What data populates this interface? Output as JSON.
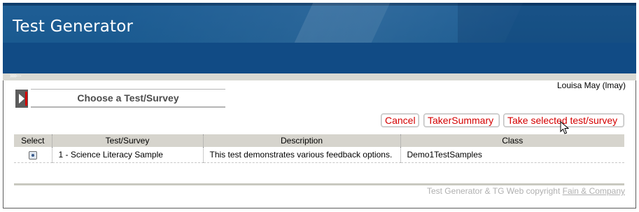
{
  "header": {
    "title": "Test Generator",
    "user": "Louisa May (lmay)"
  },
  "panel": {
    "title": "Choose a Test/Survey"
  },
  "actions": {
    "cancel": "Cancel",
    "taker_summary": "TakerSummary",
    "take_selected": "Take selected test/survey"
  },
  "table": {
    "columns": [
      "Select",
      "Test/Survey",
      "Description",
      "Class"
    ],
    "rows": [
      {
        "selected": true,
        "test": "1 - Science Literacy Sample",
        "description": "This test demonstrates various feedback options.",
        "class": "Demo1TestSamples"
      }
    ]
  },
  "footer": {
    "text": "Test Generator & TG Web copyright",
    "link": "Fain & Company"
  },
  "colors": {
    "banner": "#1a5a90",
    "button_text": "#d40000",
    "table_header": "#d6d4cd"
  },
  "icons": {
    "panel_marker": "play-arrow-icon",
    "cursor": "mouse-pointer-icon",
    "strip": "double-chevron-icon"
  }
}
